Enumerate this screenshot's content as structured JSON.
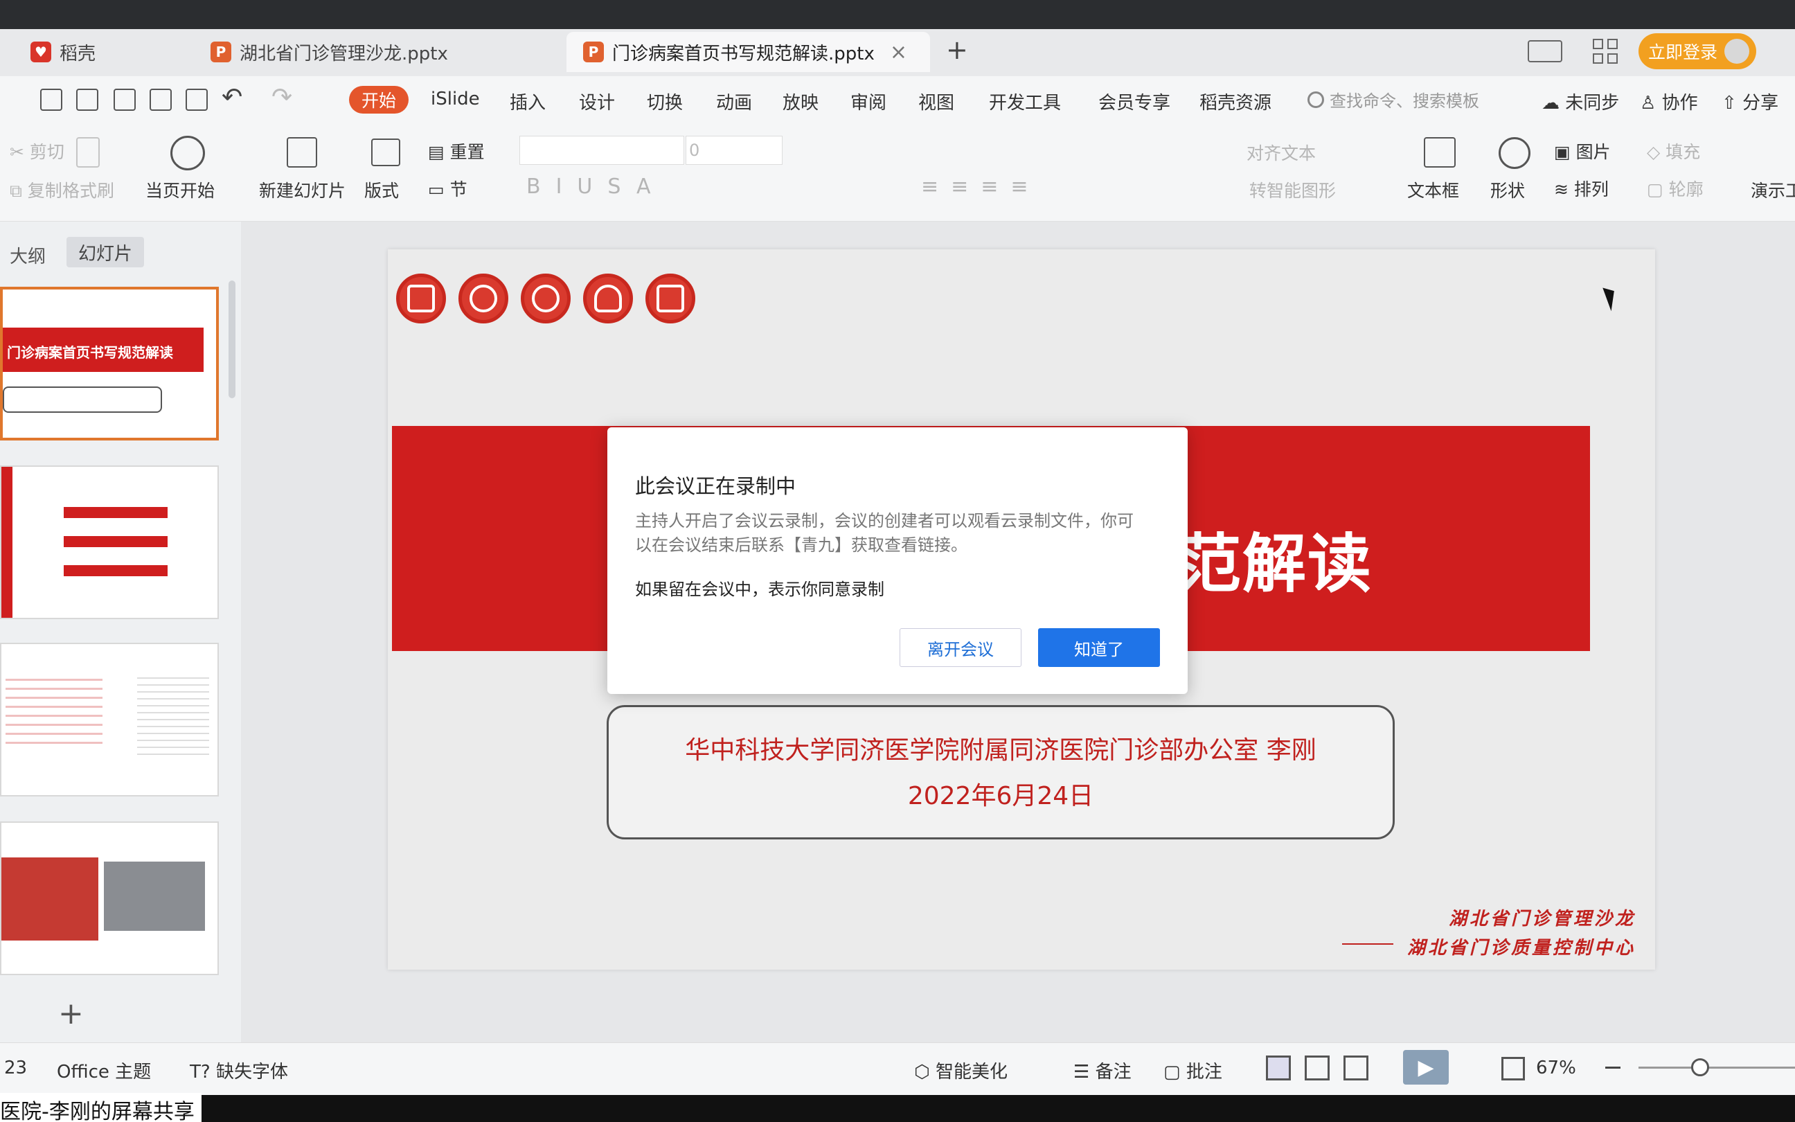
{
  "tabs": [
    {
      "label": "稻壳",
      "icon": "daoke-logo-icon",
      "color": "#d9352a"
    },
    {
      "label": "湖北省门诊管理沙龙.pptx",
      "icon": "ppt-file-icon",
      "color": "#e0612f"
    },
    {
      "label": "门诊病案首页书写规范解读.pptx",
      "icon": "ppt-file-icon",
      "color": "#e0612f",
      "active": true
    }
  ],
  "titlebar": {
    "login_label": "立即登录",
    "login_color": "#f2a020"
  },
  "menu": {
    "start": "开始",
    "items": [
      "iSlide",
      "插入",
      "设计",
      "切换",
      "动画",
      "放映",
      "审阅",
      "视图",
      "开发工具",
      "会员专享",
      "稻壳资源"
    ],
    "search_placeholder": "查找命令、搜索模板",
    "sync": "未同步",
    "collab": "协作",
    "share": "分享",
    "accent": "#e4552b"
  },
  "ribbon": {
    "cut": "剪切",
    "copy": "复制",
    "format_painter": "格式刷",
    "from_current": "当页开始",
    "new_slide": "新建幻灯片",
    "layout": "版式",
    "reset": "重置",
    "section": "节",
    "font_size": "0",
    "align_text": "对齐文本",
    "smartart": "转智能图形",
    "textbox": "文本框",
    "shape": "形状",
    "picture": "图片",
    "arrange": "排列",
    "fill": "填充",
    "outline": "轮廓",
    "present": "演示工"
  },
  "left_pane": {
    "outline_tab": "大纲",
    "slides_tab": "幻灯片",
    "thumb1_title": "门诊病案首页书写规范解读",
    "add_icon": "plus-icon"
  },
  "slide": {
    "title_visible": "范解读",
    "affiliation": "华中科技大学同济医学院附属同济医院门诊部办公室  李刚",
    "date": "2022年6月24日",
    "signature_line1": "湖北省门诊管理沙龙",
    "signature_line2": "湖北省门诊质量控制中心",
    "accent": "#cf1e1e"
  },
  "dialog": {
    "title": "此会议正在录制中",
    "body": "主持人开启了会议云录制，会议的创建者可以观看云录制文件，你可以在会议结束后联系【青九】获取查看链接。",
    "consent": "如果留在会议中，表示你同意录制",
    "leave": "离开会议",
    "ok": "知道了",
    "button_color": "#1f74e8"
  },
  "status": {
    "slide_num": "23",
    "theme": "Office 主题",
    "missing_font": "缺失字体",
    "beautify": "智能美化",
    "notes": "备注",
    "comments": "批注",
    "zoom": "67%"
  },
  "share_banner": "医院-李刚的屏幕共享"
}
